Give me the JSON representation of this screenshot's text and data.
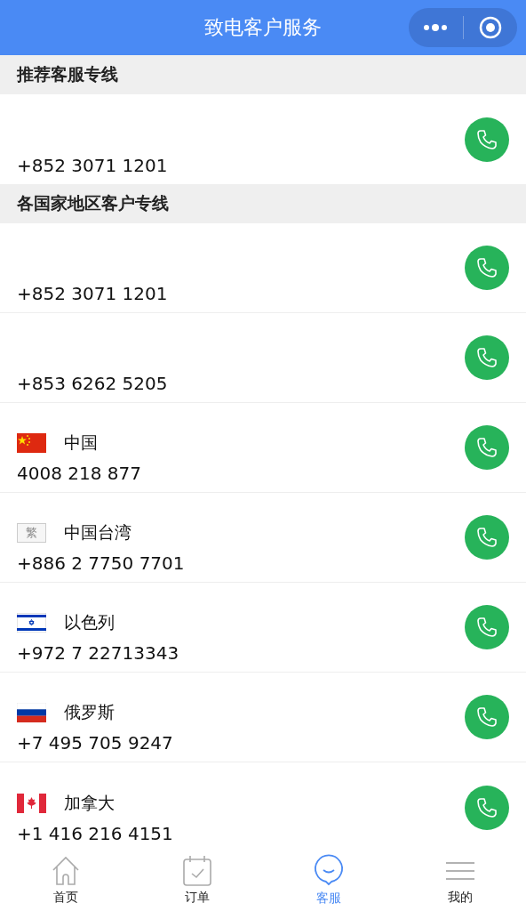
{
  "header": {
    "title": "致电客户服务"
  },
  "sections": [
    {
      "title": "推荐客服专线",
      "items": [
        {
          "number": "+852 3071 1201"
        }
      ]
    },
    {
      "title": "各国家地区客户专线",
      "items": [
        {
          "number": "+852 3071 1201"
        },
        {
          "number": "+853 6262 5205"
        },
        {
          "flag": {
            "kind": "cn"
          },
          "name": "中国",
          "number": "4008 218 877"
        },
        {
          "flag": {
            "kind": "text",
            "label": "繁"
          },
          "name": "中国台湾",
          "number": "+886 2 7750 7701"
        },
        {
          "flag": {
            "kind": "il"
          },
          "name": "以色列",
          "number": "+972 7 22713343"
        },
        {
          "flag": {
            "kind": "ru"
          },
          "name": "俄罗斯",
          "number": "+7 495 705 9247"
        },
        {
          "flag": {
            "kind": "ca"
          },
          "name": "加拿大",
          "number": "+1 416 216 4151"
        }
      ]
    }
  ],
  "tabs": [
    {
      "kind": "home",
      "label": "首页",
      "selected": false
    },
    {
      "kind": "orders",
      "label": "订单",
      "selected": false
    },
    {
      "kind": "service",
      "label": "客服",
      "selected": true
    },
    {
      "kind": "me",
      "label": "我的",
      "selected": false
    }
  ]
}
